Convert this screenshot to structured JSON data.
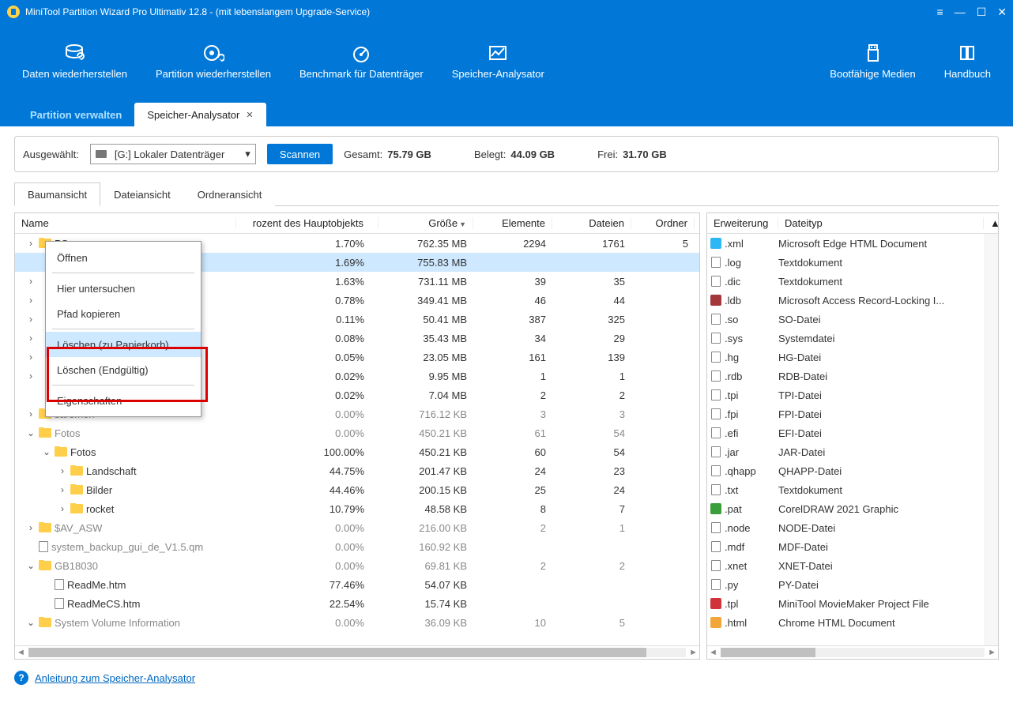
{
  "titlebar": {
    "title": "MiniTool Partition Wizard Pro Ultimativ 12.8 - (mit lebenslangem Upgrade-Service)"
  },
  "toolbar": {
    "btn_recover_data": "Daten wiederherstellen",
    "btn_recover_part": "Partition wiederherstellen",
    "btn_benchmark": "Benchmark für Datenträger",
    "btn_analyzer": "Speicher-Analysator",
    "btn_bootable": "Bootfähige Medien",
    "btn_handbook": "Handbuch"
  },
  "tabs": {
    "manage": "Partition verwalten",
    "analyzer": "Speicher-Analysator"
  },
  "selbar": {
    "label": "Ausgewählt:",
    "drive": "[G:] Lokaler Datenträger",
    "scan": "Scannen",
    "total_lbl": "Gesamt:",
    "total_val": "75.79 GB",
    "used_lbl": "Belegt:",
    "used_val": "44.09 GB",
    "free_lbl": "Frei:",
    "free_val": "31.70 GB"
  },
  "view_tabs": {
    "tree": "Baumansicht",
    "file": "Dateiansicht",
    "folder": "Ordneransicht"
  },
  "cols": {
    "name": "Name",
    "pct": "rozent des Hauptobjekts",
    "size": "Größe",
    "elem": "Elemente",
    "files": "Dateien",
    "folders": "Ordner"
  },
  "ext_cols": {
    "ext": "Erweiterung",
    "type": "Dateityp"
  },
  "tree": [
    {
      "depth": 0,
      "chev": ">",
      "icon": "folder",
      "name": "PS",
      "pct": "1.70%",
      "size": "762.35 MB",
      "elem": "2294",
      "files": "1761",
      "folders": "5"
    },
    {
      "depth": 0,
      "chev": "",
      "icon": "",
      "name": "",
      "pct": "1.69%",
      "size": "755.83 MB",
      "elem": "",
      "files": "",
      "folders": "",
      "sel": true
    },
    {
      "depth": 0,
      "chev": ">",
      "icon": "",
      "name": "",
      "pct": "1.63%",
      "size": "731.11 MB",
      "elem": "39",
      "files": "35",
      "folders": ""
    },
    {
      "depth": 0,
      "chev": ">",
      "icon": "",
      "name": "",
      "pct": "0.78%",
      "size": "349.41 MB",
      "elem": "46",
      "files": "44",
      "folders": ""
    },
    {
      "depth": 0,
      "chev": ">",
      "icon": "",
      "name": "",
      "pct": "0.11%",
      "size": "50.41 MB",
      "elem": "387",
      "files": "325",
      "folders": ""
    },
    {
      "depth": 0,
      "chev": ">",
      "icon": "",
      "name": "",
      "pct": "0.08%",
      "size": "35.43 MB",
      "elem": "34",
      "files": "29",
      "folders": ""
    },
    {
      "depth": 0,
      "chev": ">",
      "icon": "",
      "name": "",
      "pct": "0.05%",
      "size": "23.05 MB",
      "elem": "161",
      "files": "139",
      "folders": ""
    },
    {
      "depth": 0,
      "chev": ">",
      "icon": "",
      "name": "",
      "pct": "0.02%",
      "size": "9.95 MB",
      "elem": "1",
      "files": "1",
      "folders": ""
    },
    {
      "depth": 0,
      "chev": "",
      "icon": "",
      "name": "",
      "pct": "0.02%",
      "size": "7.04 MB",
      "elem": "2",
      "files": "2",
      "folders": ""
    },
    {
      "depth": 0,
      "chev": ">",
      "icon": "folder",
      "name": "saremon",
      "pct": "0.00%",
      "size": "716.12 KB",
      "elem": "3",
      "files": "3",
      "folders": "",
      "dim": true,
      "partial": true
    },
    {
      "depth": 0,
      "chev": "v",
      "icon": "folder",
      "name": "Fotos",
      "pct": "0.00%",
      "size": "450.21 KB",
      "elem": "61",
      "files": "54",
      "folders": "",
      "dim": true
    },
    {
      "depth": 1,
      "chev": "v",
      "icon": "folder",
      "name": "Fotos",
      "pct": "100.00%",
      "size": "450.21 KB",
      "elem": "60",
      "files": "54",
      "folders": ""
    },
    {
      "depth": 2,
      "chev": ">",
      "icon": "folder",
      "name": "Landschaft",
      "pct": "44.75%",
      "size": "201.47 KB",
      "elem": "24",
      "files": "23",
      "folders": ""
    },
    {
      "depth": 2,
      "chev": ">",
      "icon": "folder",
      "name": "Bilder",
      "pct": "44.46%",
      "size": "200.15 KB",
      "elem": "25",
      "files": "24",
      "folders": ""
    },
    {
      "depth": 2,
      "chev": ">",
      "icon": "folder",
      "name": "rocket",
      "pct": "10.79%",
      "size": "48.58 KB",
      "elem": "8",
      "files": "7",
      "folders": ""
    },
    {
      "depth": 0,
      "chev": ">",
      "icon": "folder",
      "name": "$AV_ASW",
      "pct": "0.00%",
      "size": "216.00 KB",
      "elem": "2",
      "files": "1",
      "folders": "",
      "dim": true
    },
    {
      "depth": 0,
      "chev": "",
      "icon": "page",
      "name": "system_backup_gui_de_V1.5.qm",
      "pct": "0.00%",
      "size": "160.92 KB",
      "elem": "",
      "files": "",
      "folders": "",
      "dim": true
    },
    {
      "depth": 0,
      "chev": "v",
      "icon": "folder",
      "name": "GB18030",
      "pct": "0.00%",
      "size": "69.81 KB",
      "elem": "2",
      "files": "2",
      "folders": "",
      "dim": true
    },
    {
      "depth": 1,
      "chev": "",
      "icon": "page",
      "name": "ReadMe.htm",
      "pct": "77.46%",
      "size": "54.07 KB",
      "elem": "",
      "files": "",
      "folders": ""
    },
    {
      "depth": 1,
      "chev": "",
      "icon": "page",
      "name": "ReadMeCS.htm",
      "pct": "22.54%",
      "size": "15.74 KB",
      "elem": "",
      "files": "",
      "folders": ""
    },
    {
      "depth": 0,
      "chev": "v",
      "icon": "folder",
      "name": "System Volume Information",
      "pct": "0.00%",
      "size": "36.09 KB",
      "elem": "10",
      "files": "5",
      "folders": "",
      "dim": true
    }
  ],
  "exts": [
    {
      "i": "edge",
      "e": ".xml",
      "t": "Microsoft Edge HTML Document"
    },
    {
      "i": "page",
      "e": ".log",
      "t": "Textdokument"
    },
    {
      "i": "page",
      "e": ".dic",
      "t": "Textdokument"
    },
    {
      "i": "access",
      "e": ".ldb",
      "t": "Microsoft Access Record-Locking I..."
    },
    {
      "i": "page",
      "e": ".so",
      "t": "SO-Datei"
    },
    {
      "i": "page",
      "e": ".sys",
      "t": "Systemdatei"
    },
    {
      "i": "page",
      "e": ".hg",
      "t": "HG-Datei"
    },
    {
      "i": "page",
      "e": ".rdb",
      "t": "RDB-Datei"
    },
    {
      "i": "page",
      "e": ".tpi",
      "t": "TPI-Datei"
    },
    {
      "i": "page",
      "e": ".fpi",
      "t": "FPI-Datei"
    },
    {
      "i": "page",
      "e": ".efi",
      "t": "EFI-Datei"
    },
    {
      "i": "page",
      "e": ".jar",
      "t": "JAR-Datei"
    },
    {
      "i": "page",
      "e": ".qhapp",
      "t": "QHAPP-Datei"
    },
    {
      "i": "page",
      "e": ".txt",
      "t": "Textdokument"
    },
    {
      "i": "corel",
      "e": ".pat",
      "t": "CorelDRAW 2021 Graphic"
    },
    {
      "i": "page",
      "e": ".node",
      "t": "NODE-Datei"
    },
    {
      "i": "page",
      "e": ".mdf",
      "t": "MDF-Datei"
    },
    {
      "i": "page",
      "e": ".xnet",
      "t": "XNET-Datei"
    },
    {
      "i": "page",
      "e": ".py",
      "t": "PY-Datei"
    },
    {
      "i": "mm",
      "e": ".tpl",
      "t": "MiniTool MovieMaker Project File"
    },
    {
      "i": "chrome",
      "e": ".html",
      "t": "Chrome HTML Document"
    }
  ],
  "ctx": {
    "open": "Öffnen",
    "inspect": "Hier untersuchen",
    "copy": "Pfad kopieren",
    "del_recycle": "Löschen (zu Papierkorb)",
    "del_perm": "Löschen (Endgültig)",
    "props": "Eigenschaften"
  },
  "footer": {
    "link": "Anleitung zum Speicher-Analysator"
  }
}
